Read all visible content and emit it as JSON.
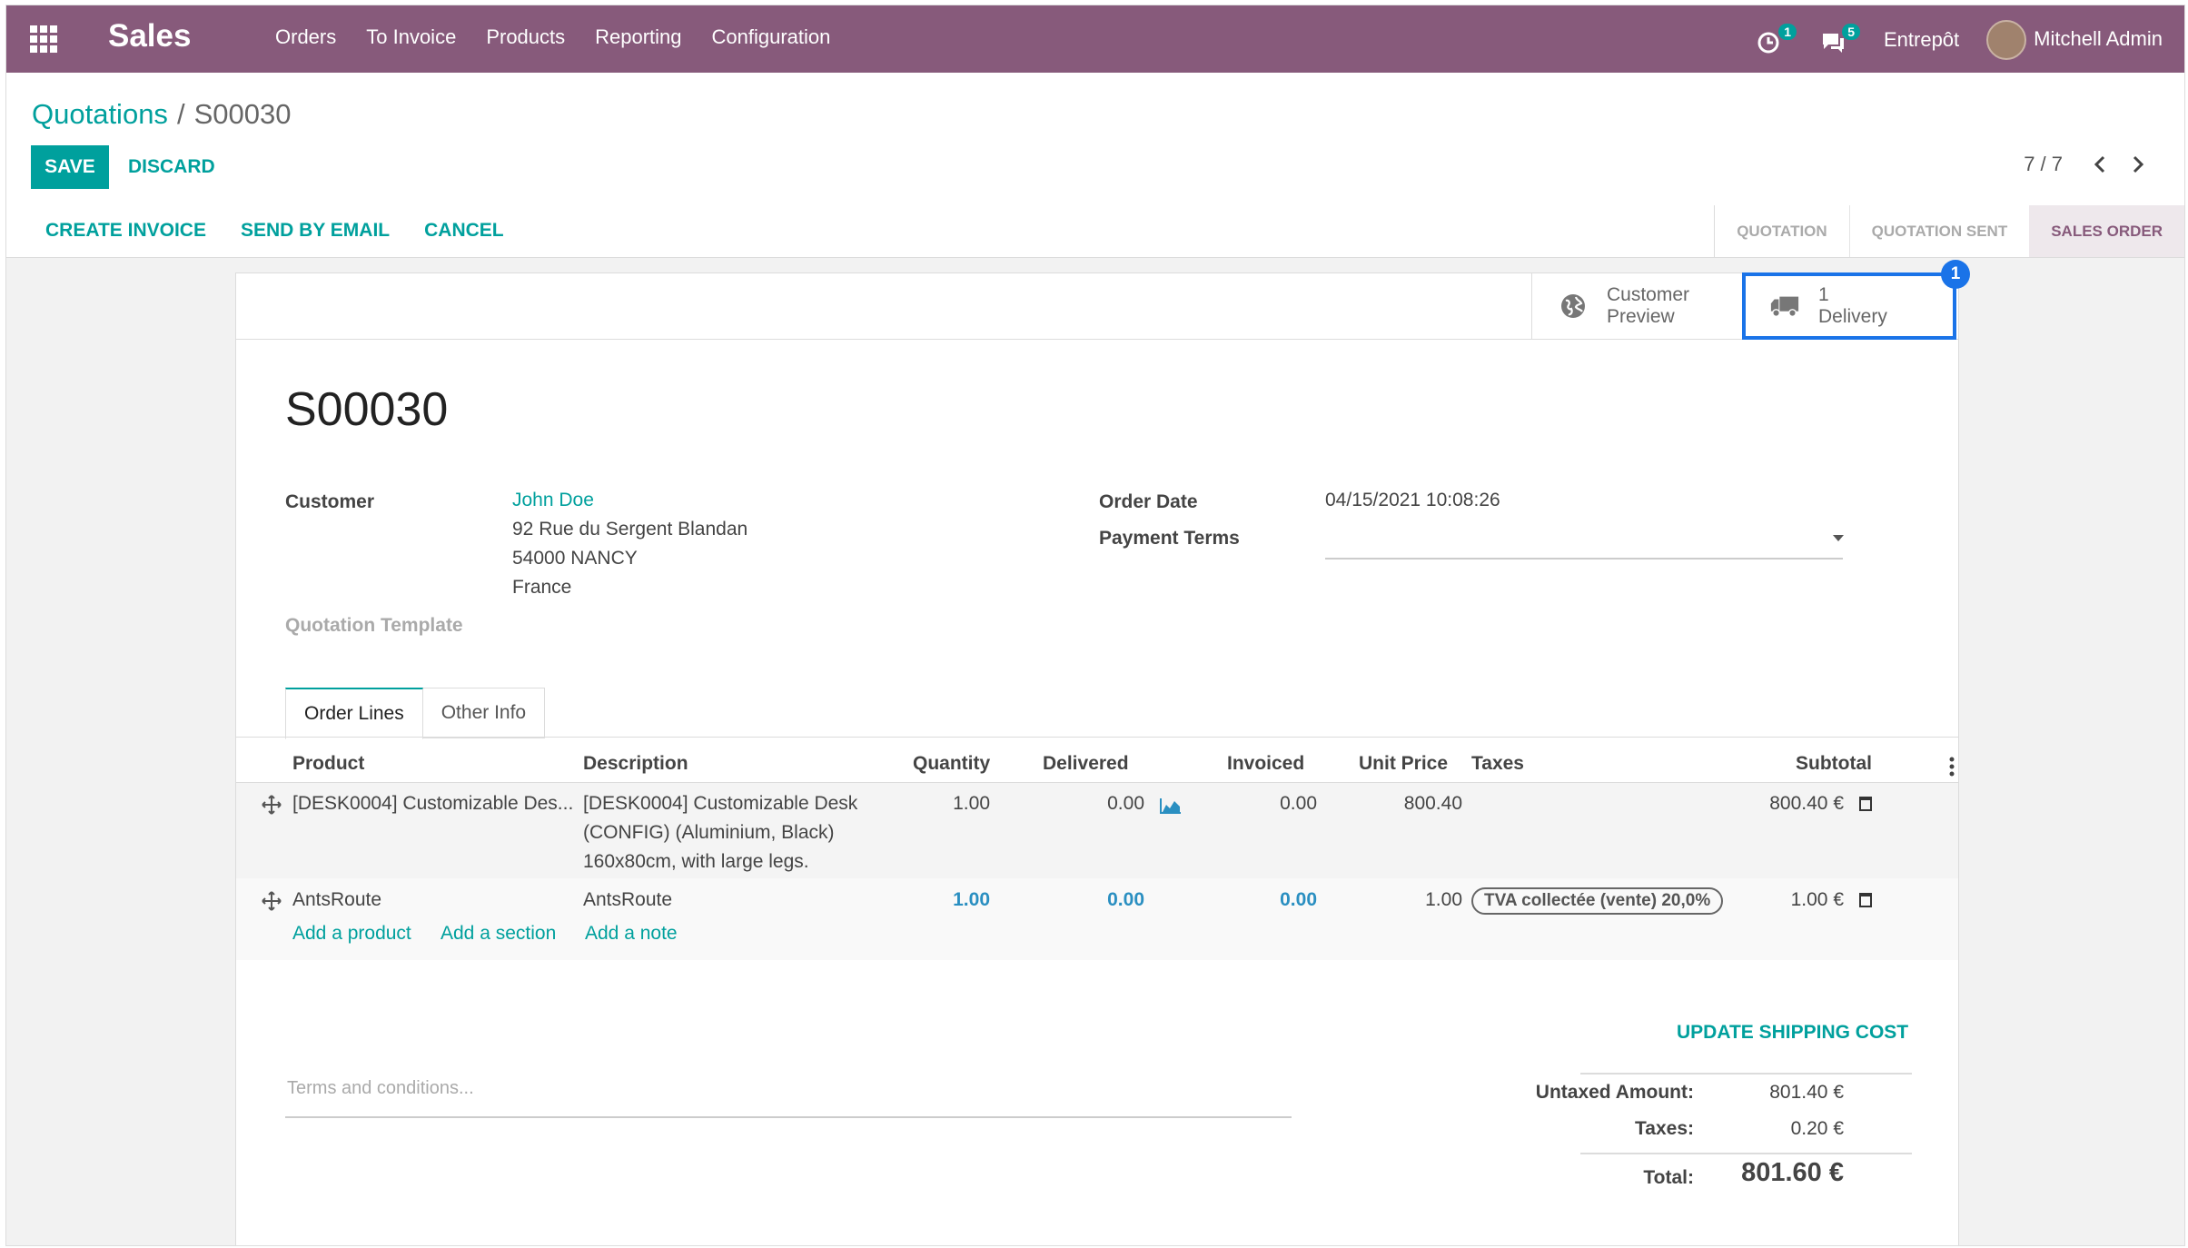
{
  "topbar": {
    "app_name": "Sales",
    "menu": [
      "Orders",
      "To Invoice",
      "Products",
      "Reporting",
      "Configuration"
    ],
    "activity_count": "1",
    "message_count": "5",
    "company": "Entrepôt",
    "user": "Mitchell Admin"
  },
  "breadcrumb": {
    "parent": "Quotations",
    "separator": "/",
    "current": "S00030"
  },
  "buttons": {
    "save": "SAVE",
    "discard": "DISCARD"
  },
  "pager": {
    "value": "7 / 7"
  },
  "actions": {
    "create_invoice": "CREATE INVOICE",
    "send_email": "SEND BY EMAIL",
    "cancel": "CANCEL"
  },
  "stages": [
    "QUOTATION",
    "QUOTATION SENT",
    "SALES ORDER"
  ],
  "stage_active": "SALES ORDER",
  "smart_buttons": {
    "preview_line1": "Customer",
    "preview_line2": "Preview",
    "delivery_count": "1",
    "delivery_label": "Delivery",
    "highlight_number": "1"
  },
  "order": {
    "name": "S00030",
    "customer_label": "Customer",
    "customer_name": "John Doe",
    "address_1": "92 Rue du Sergent Blandan",
    "address_2": "54000 NANCY",
    "address_3": "France",
    "template_label": "Quotation Template",
    "order_date_label": "Order Date",
    "order_date": "04/15/2021 10:08:26",
    "payment_terms_label": "Payment Terms"
  },
  "tabs": [
    "Order Lines",
    "Other Info"
  ],
  "table": {
    "headers": [
      "Product",
      "Description",
      "Quantity",
      "Delivered",
      "Invoiced",
      "Unit Price",
      "Taxes",
      "Subtotal"
    ],
    "rows": [
      {
        "product": "[DESK0004] Customizable Des...",
        "description_1": "[DESK0004] Customizable Desk",
        "description_2": "(CONFIG) (Aluminium, Black)",
        "description_3": "160x80cm, with large legs.",
        "quantity": "1.00",
        "delivered": "0.00",
        "invoiced": "0.00",
        "unit_price": "800.40",
        "subtotal": "800.40 €"
      },
      {
        "product": "AntsRoute",
        "description": "AntsRoute",
        "quantity": "1.00",
        "delivered": "0.00",
        "invoiced": "0.00",
        "unit_price": "1.00",
        "tax": "TVA collectée (vente) 20,0%",
        "subtotal": "1.00 €"
      }
    ],
    "add_product": "Add a product",
    "add_section": "Add a section",
    "add_note": "Add a note"
  },
  "footer": {
    "update_shipping": "UPDATE SHIPPING COST",
    "terms_placeholder": "Terms and conditions...",
    "untaxed_label": "Untaxed Amount:",
    "untaxed_value": "801.40 €",
    "taxes_label": "Taxes:",
    "taxes_value": "0.20 €",
    "total_label": "Total:",
    "total_value": "801.60 €"
  },
  "colors": {
    "brand": "#875a7b",
    "accent": "#00a09d",
    "highlight": "#1a73e8"
  }
}
